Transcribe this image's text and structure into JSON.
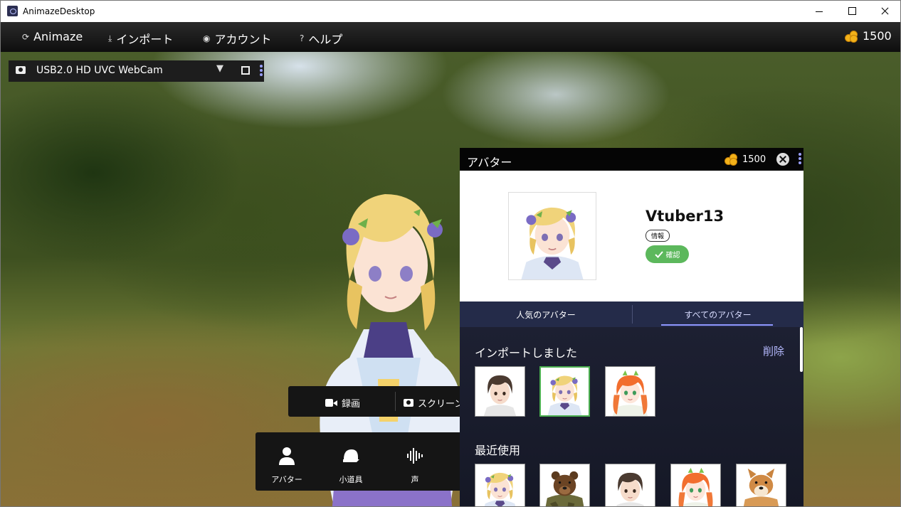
{
  "window": {
    "title": "AnimazeDesktop"
  },
  "menu": {
    "items": [
      {
        "label": "Animaze",
        "icon": "animaze-icon"
      },
      {
        "label": "インポート",
        "icon": "import-icon"
      },
      {
        "label": "アカウント",
        "icon": "account-icon"
      },
      {
        "label": "ヘルプ",
        "icon": "help-icon"
      }
    ],
    "coins": "1500"
  },
  "camera": {
    "device": "USB2.0 HD UVC WebCam"
  },
  "recording": {
    "record_label": "録画",
    "screenshot_label": "スクリーン"
  },
  "toolbar": {
    "items": [
      {
        "label": "アバター"
      },
      {
        "label": "小道具"
      },
      {
        "label": "声"
      }
    ]
  },
  "panel": {
    "title": "アバター",
    "coins": "1500",
    "selected": {
      "name": "Vtuber13",
      "info_label": "情報",
      "confirm_label": "確認"
    },
    "tabs": [
      {
        "label": "人気のアバター"
      },
      {
        "label": "すべてのアバター",
        "active": true
      }
    ],
    "imported": {
      "title": "インポートしました",
      "delete_label": "削除",
      "avatars": [
        "brown-hair-boy-avatar",
        "blonde-vtuber-avatar",
        "orange-hair-girl-avatar"
      ]
    },
    "recent": {
      "title": "最近使用",
      "avatars": [
        "blonde-vtuber-avatar",
        "bear-avatar",
        "brown-hair-boy-avatar",
        "orange-hair-girl-avatar",
        "shiba-dog-avatar"
      ]
    }
  },
  "colors": {
    "accent": "#8f97ff",
    "confirm": "#5cb85c",
    "coin": "#f3b21a",
    "panel_bg": "#1a1e2e"
  }
}
